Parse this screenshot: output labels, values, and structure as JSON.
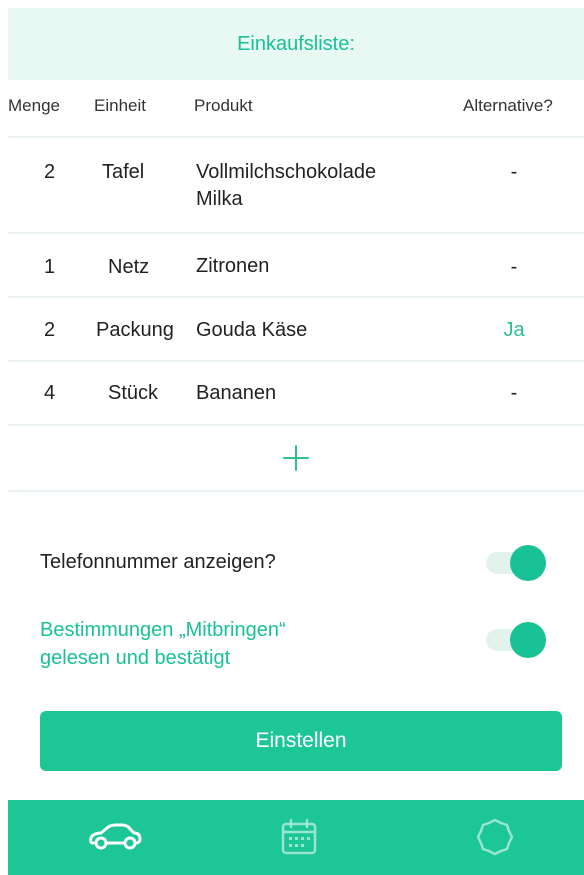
{
  "header": {
    "title": "Einkaufsliste:"
  },
  "columns": {
    "menge": "Menge",
    "einheit": "Einheit",
    "produkt": "Produkt",
    "alternative": "Alternative?"
  },
  "items": [
    {
      "qty": "2",
      "unit": "Tafel",
      "product_line1": "Vollmilchschokolade",
      "product_line2": "Milka",
      "alternative": "-"
    },
    {
      "qty": "1",
      "unit": "Netz",
      "product_line1": "Zitronen",
      "product_line2": "",
      "alternative": "-"
    },
    {
      "qty": "2",
      "unit": "Packung",
      "product_line1": "Gouda Käse",
      "product_line2": "",
      "alternative": "Ja"
    },
    {
      "qty": "4",
      "unit": "Stück",
      "product_line1": "Bananen",
      "product_line2": "",
      "alternative": "-"
    }
  ],
  "add_item": {
    "icon": "plus-icon"
  },
  "settings": {
    "phone": {
      "label": "Telefonnummer anzeigen?",
      "enabled": true
    },
    "terms": {
      "label_line1": "Bestimmungen „Mitbringen“",
      "label_line2": "gelesen und bestätigt",
      "enabled": true
    }
  },
  "submit": {
    "label": "Einstellen"
  },
  "nav": {
    "items": [
      {
        "icon": "car-icon"
      },
      {
        "icon": "calendar-icon"
      },
      {
        "icon": "settings-gear-icon"
      }
    ]
  },
  "colors": {
    "accent": "#1cc697",
    "header_bg": "#e8f8f3",
    "toggle_track": "#e3f3ec"
  }
}
